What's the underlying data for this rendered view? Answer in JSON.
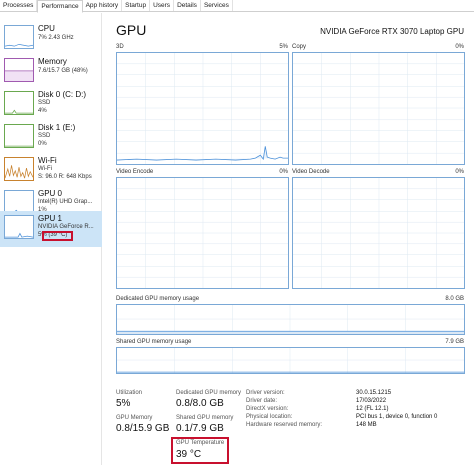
{
  "tabs": [
    "Processes",
    "Performance",
    "App history",
    "Startup",
    "Users",
    "Details",
    "Services"
  ],
  "sidebar": {
    "items": [
      {
        "name": "CPU",
        "line1": "7%  2.43 GHz",
        "line2": ""
      },
      {
        "name": "Memory",
        "line1": "7.6/15.7 GB (48%)",
        "line2": ""
      },
      {
        "name": "Disk 0 (C: D:)",
        "line1": "SSD",
        "line2": "4%"
      },
      {
        "name": "Disk 1 (E:)",
        "line1": "SSD",
        "line2": "0%"
      },
      {
        "name": "Wi-Fi",
        "line1": "Wi-Fi",
        "line2": "S: 96.0  R: 648 Kbps"
      },
      {
        "name": "GPU 0",
        "line1": "Intel(R) UHD Grap...",
        "line2": "1%"
      },
      {
        "name": "GPU 1",
        "line1": "NVIDIA GeForce R...",
        "line2": "5%  (39 °C)"
      }
    ]
  },
  "main": {
    "title": "GPU",
    "model": "NVIDIA GeForce RTX 3070 Laptop GPU",
    "engines": [
      {
        "label": "3D",
        "pct": "5%"
      },
      {
        "label": "Copy",
        "pct": "0%"
      },
      {
        "label": "Video Encode",
        "pct": "0%"
      },
      {
        "label": "Video Decode",
        "pct": "0%"
      }
    ],
    "dedicated": {
      "label": "Dedicated GPU memory usage",
      "max": "8.0 GB"
    },
    "shared": {
      "label": "Shared GPU memory usage",
      "max": "7.9 GB"
    }
  },
  "stats": {
    "utilization": {
      "label": "Utilization",
      "value": "5%"
    },
    "dedicated_mem": {
      "label": "Dedicated GPU memory",
      "value": "0.8/8.0 GB"
    },
    "gpu_memory": {
      "label": "GPU Memory",
      "value": "0.8/15.9 GB"
    },
    "shared_mem": {
      "label": "Shared GPU memory",
      "value": "0.1/7.9 GB"
    },
    "temperature": {
      "label": "GPU Temperature",
      "value": "39 °C"
    }
  },
  "info": [
    {
      "key": "Driver version:",
      "value": "30.0.15.1215"
    },
    {
      "key": "Driver date:",
      "value": "17/03/2022"
    },
    {
      "key": "DirectX version:",
      "value": "12 (FL 12.1)"
    },
    {
      "key": "Physical location:",
      "value": "PCI bus 1, device 0, function 0"
    },
    {
      "key": "Hardware reserved memory:",
      "value": "148 MB"
    }
  ],
  "colors": {
    "accent": "#7aa8d6",
    "highlight": "#c8102e",
    "selected": "#cce4f7"
  }
}
